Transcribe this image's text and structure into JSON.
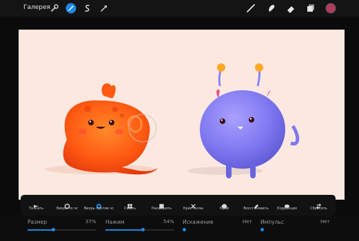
{
  "topbar": {
    "gallery_label": "Галерея",
    "left_icons": [
      "wrench-icon",
      "magic-wand-icon",
      "selection-icon",
      "transform-icon"
    ],
    "right_icons": [
      "brush-icon",
      "smudge-icon",
      "eraser-icon",
      "layers-icon",
      "color-swatch-icon"
    ],
    "active_color": "#b33a5f",
    "accent": "#1e88e5"
  },
  "liquify": {
    "modes": [
      {
        "label": "Толкать",
        "icon": "push-icon",
        "active": false
      },
      {
        "label": "Вихрь по чс",
        "icon": "twirl-right-icon",
        "active": false
      },
      {
        "label": "Вихрь против чс",
        "icon": "twirl-left-icon",
        "active": true
      },
      {
        "label": "Сжать",
        "icon": "pinch-icon",
        "active": false
      },
      {
        "label": "Расширить",
        "icon": "expand-icon",
        "active": false
      },
      {
        "label": "Кристаллы",
        "icon": "crystals-icon",
        "active": false
      },
      {
        "label": "Край",
        "icon": "edge-icon",
        "active": false
      },
      {
        "label": "Восстановить",
        "icon": "reconstruct-icon",
        "active": false
      },
      {
        "label": "Коррекция",
        "icon": "adjust-icon",
        "active": false
      },
      {
        "label": "Сбросить",
        "icon": "reset-icon",
        "active": false
      }
    ]
  },
  "params": {
    "size": {
      "label": "Размер",
      "value": "37%",
      "fraction": 0.37
    },
    "pressure": {
      "label": "Нажим",
      "value": "54%",
      "fraction": 0.54
    },
    "distortion": {
      "label": "Искажение",
      "value": "Нет"
    },
    "momentum": {
      "label": "Импульс",
      "value": "Нет"
    }
  }
}
